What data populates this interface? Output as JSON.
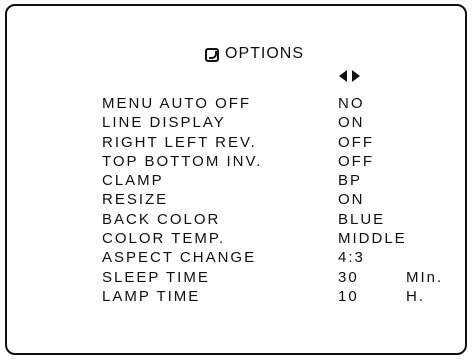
{
  "menu": {
    "title": "OPTIONS",
    "icon": "options-icon",
    "navigation": "left-right-arrows",
    "items": [
      {
        "label": "MENU AUTO OFF",
        "value": "NO"
      },
      {
        "label": "LINE DISPLAY",
        "value": "ON"
      },
      {
        "label": "RIGHT LEFT REV.",
        "value": "OFF"
      },
      {
        "label": "TOP BOTTOM INV.",
        "value": "OFF"
      },
      {
        "label": "CLAMP",
        "value": "BP"
      },
      {
        "label": "RESIZE",
        "value": "ON"
      },
      {
        "label": "BACK COLOR",
        "value": "BLUE"
      },
      {
        "label": "COLOR TEMP.",
        "value": "MIDDLE"
      },
      {
        "label": "ASPECT CHANGE",
        "value": "4:3"
      },
      {
        "label": "SLEEP TIME",
        "value": "30",
        "unit": "MIn."
      },
      {
        "label": "LAMP TIME",
        "value": "10",
        "unit": "H."
      }
    ]
  },
  "colors": {
    "background": "#ffffff",
    "foreground": "#111111"
  }
}
